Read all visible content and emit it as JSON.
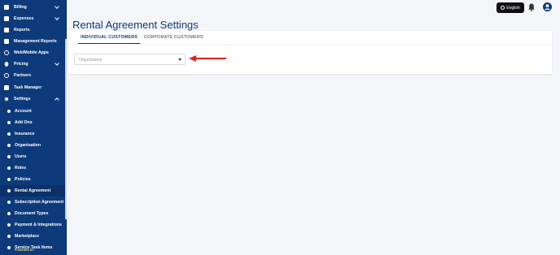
{
  "sidebar": {
    "items": [
      {
        "label": "Billing",
        "icon": "billing-icon",
        "chevron": "down"
      },
      {
        "label": "Expenses",
        "icon": "expenses-icon",
        "chevron": "down"
      },
      {
        "label": "Reports",
        "icon": "reports-icon"
      },
      {
        "label": "Management Reports",
        "icon": "management-reports-icon"
      },
      {
        "label": "Web/Mobile Apps",
        "icon": "globe-icon"
      },
      {
        "label": "Pricing",
        "icon": "tag-icon",
        "chevron": "down"
      },
      {
        "label": "Partners",
        "icon": "handshake-icon"
      },
      {
        "label": "Task Manager",
        "icon": "calendar-icon"
      },
      {
        "label": "Settings",
        "icon": "gear-icon",
        "chevron": "up"
      }
    ],
    "settings_sub": [
      "Account",
      "Add Ons",
      "Insurance",
      "Organisation",
      "Users",
      "Roles",
      "Policies",
      "Rental Agreement",
      "Subscription Agreement",
      "Document Types",
      "Payment & Integrations",
      "Marketplace",
      "Service Task Items"
    ],
    "active_sub": "Rental Agreement",
    "powered_by": "POWERED BY"
  },
  "topbar": {
    "language_label": "English",
    "bell_icon": "bell-icon",
    "user_icon": "user-avatar-icon"
  },
  "page": {
    "title": "Rental Agreement Settings",
    "tabs": [
      {
        "label": "INDIVIDUAL CUSTOMERS",
        "active": true
      },
      {
        "label": "CORPORATE CUSTOMERS",
        "active": false
      }
    ],
    "select_placeholder": "Organisation"
  },
  "colors": {
    "sidebar_bg": "#0d3a7a",
    "accent": "#0d3a7a",
    "arrow": "#e02020"
  }
}
